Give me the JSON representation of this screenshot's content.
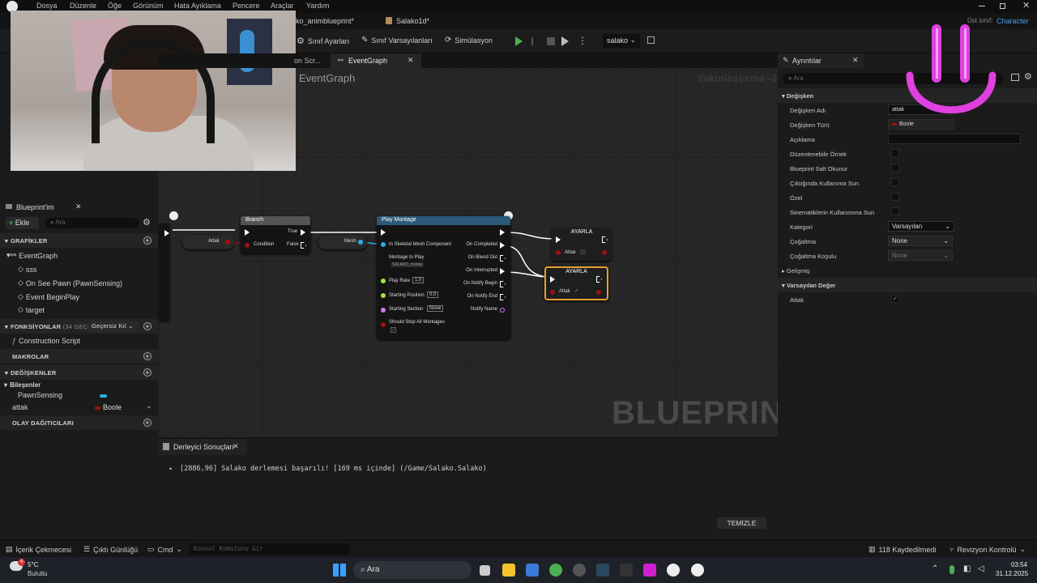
{
  "menu": [
    "Dosya",
    "Düzenle",
    "Öğe",
    "Görünüm",
    "Hata Ayıklama",
    "Pencere",
    "Araçlar",
    "Yardım"
  ],
  "tabs": {
    "anim": "ko_animblueprint*",
    "salako": "Salako1d*"
  },
  "parent": {
    "label": "Üst sınıf:",
    "value": "Character"
  },
  "toolbar": {
    "class_settings": "Sınıf Ayarları",
    "class_defaults": "Sınıf Varsayılanları",
    "simulation": "Simülasyon",
    "debug_target": "salako"
  },
  "graph_tabs": {
    "construct": "on Scr...",
    "event": "EventGraph"
  },
  "graph": {
    "title": "EventGraph",
    "zoom": "Yakınlaştırma -2",
    "watermark": "BLUEPRINT"
  },
  "nodes": {
    "var_get": "Attak",
    "branch": {
      "title": "Branch",
      "true": "True",
      "false": "False",
      "condition": "Condition"
    },
    "mesh": "Mesh",
    "montage": {
      "title": "Play Montage",
      "in_mesh": "In Skeletal Mesh Component",
      "montage_to_play": "Montage to Play",
      "montage_asset": "SALAKO_monta",
      "play_rate_lbl": "Play Rate",
      "play_rate": "1,0",
      "start_pos_lbl": "Starting Position",
      "start_pos": "0,0",
      "start_sec_lbl": "Starting Section",
      "start_sec": "None",
      "stop_all": "Should Stop All Montages",
      "out_completed": "On Completed",
      "out_blend": "On Blend Out",
      "out_interrupted": "On Interrupted",
      "out_notify_begin": "On Notify Begin",
      "out_notify_end": "On Notify End",
      "out_notify_name": "Notify Name"
    },
    "set1": {
      "title": "AYARLA",
      "var": "Attak"
    },
    "set2": {
      "title": "AYARLA",
      "var": "Attak"
    }
  },
  "left": {
    "title": "Blueprint'im",
    "add": "Ekle",
    "search_ph": "Ara",
    "graphs_hdr": "GRAFİKLER",
    "eventgraph": "EventGraph",
    "sss": "sss",
    "ev1": "On See Pawn (PawnSensing)",
    "ev2": "Event BeginPlay",
    "ev3": "target",
    "funcs_hdr": "FONKSİYONLAR",
    "funcs_count": "(34 GEÇERSİ",
    "funcs_override": "Geçersiz Kıl",
    "construction": "Construction Script",
    "macros_hdr": "MAKROLAR",
    "vars_hdr": "DEĞİŞKENLER",
    "components": "Bileşenler",
    "pawnsensing": "PawnSensing",
    "attak": "attak",
    "attak_type": "Boole",
    "dispatchers_hdr": "OLAY DAĞITICILARI"
  },
  "details": {
    "title": "Ayrıntılar",
    "search_ph": "Ara",
    "var_section": "Değişken",
    "var_name_lbl": "Değişken Adı",
    "var_name": "attak",
    "var_type_lbl": "Değişken Türü",
    "var_type": "Boole",
    "desc_lbl": "Açıklama",
    "editable_lbl": "Düzenlenebilir Örnek",
    "readonly_lbl": "Blueprint Salt Okunur",
    "expose_lbl": "Çıktığında Kullanıma Sun",
    "private_lbl": "Özel",
    "cine_lbl": "Sinematiklerin Kullanımına Sun",
    "category_lbl": "Kategori",
    "category": "Varsayılan",
    "repl_lbl": "Çoğaltma",
    "repl": "None",
    "repl_cond_lbl": "Çoğaltma Koşulu",
    "repl_cond": "None",
    "advanced": "Gelişmiş",
    "default_section": "Varsayılan Değer",
    "default_var": "Attak"
  },
  "compiler": {
    "title": "Derleyici Sonuçları",
    "log": "[2886,96] Salako derlemesi başarılı! [169 ms içinde] (/Game/Salako.Salako)",
    "clear": "TEMİZLE"
  },
  "status": {
    "content": "İçerik Çekmecesi",
    "output": "Çıktı Günlüğü",
    "cmd": "Cmd",
    "cmd_ph": "Konsol Komutunu Gir",
    "unsaved": "118 Kaydedilmedi",
    "revision": "Revizyon Kontrolü"
  },
  "taskbar": {
    "weather_temp": "5°C",
    "weather_desc": "Bulutlu",
    "search": "Ara",
    "time": "03:54",
    "date": "31.12.2025",
    "badge": "4"
  }
}
